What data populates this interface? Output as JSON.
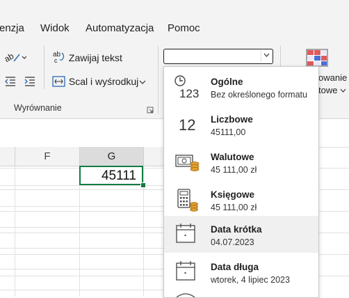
{
  "menubar": {
    "items": [
      "enzja",
      "Widok",
      "Automatyzacja",
      "Pomoc"
    ]
  },
  "ribbon": {
    "wrap_text_label": "Zawijaj tekst",
    "merge_center_label": "Scal i wyśrodkuj",
    "alignment_group_label": "Wyrównanie",
    "right_label_1": "owanie",
    "right_label_2": "towe"
  },
  "number_format": {
    "combo_value": "",
    "items": [
      {
        "title": "Ogólne",
        "subtitle": "Bez określonego formatu",
        "icon": "clock-123-icon"
      },
      {
        "title": "Liczbowe",
        "subtitle": "45111,00",
        "icon": "number-12-icon"
      },
      {
        "title": "Walutowe",
        "subtitle": "45 111,00 zł",
        "icon": "currency-icon"
      },
      {
        "title": "Księgowe",
        "subtitle": " 45 111,00 zł",
        "icon": "calculator-icon"
      },
      {
        "title": "Data krótka",
        "subtitle": "04.07.2023",
        "icon": "calendar-icon"
      },
      {
        "title": "Data długa",
        "subtitle": "wtorek, 4 lipiec 2023",
        "icon": "calendar-icon"
      }
    ]
  },
  "sheet": {
    "columns": [
      "F",
      "G"
    ],
    "selected_cell_value": "45111"
  },
  "colors": {
    "accent_green": "#107c41",
    "ribbon_bg": "#f3f3f3"
  }
}
